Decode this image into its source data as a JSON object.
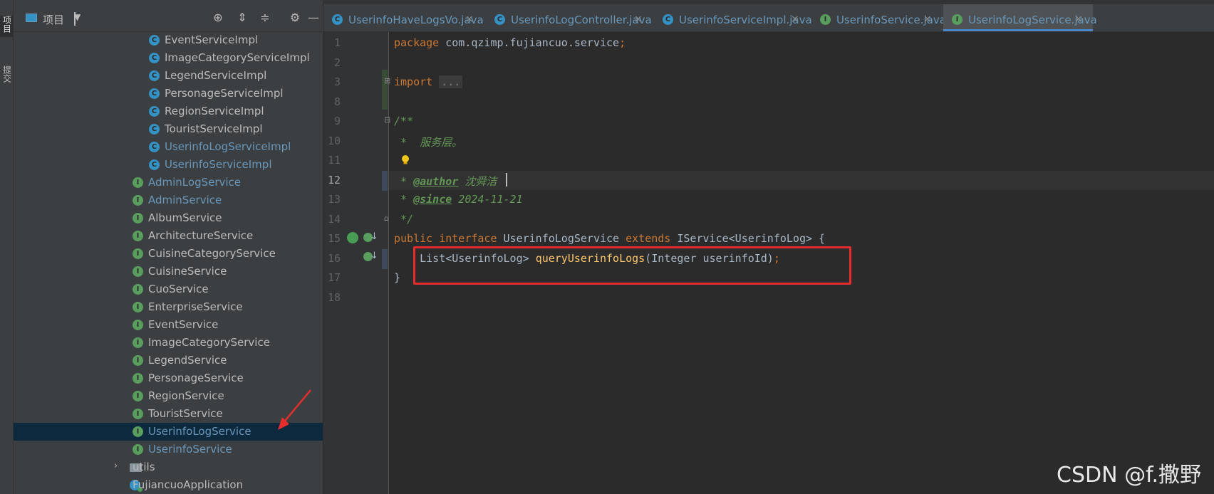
{
  "left_strip": {
    "project_tab": "项目",
    "commit_tab": "提交"
  },
  "project_panel": {
    "title": "项目",
    "tree": [
      {
        "label": "EventServiceImpl",
        "type": "class",
        "modified": false
      },
      {
        "label": "ImageCategoryServiceImpl",
        "type": "class",
        "modified": false
      },
      {
        "label": "LegendServiceImpl",
        "type": "class",
        "modified": false
      },
      {
        "label": "PersonageServiceImpl",
        "type": "class",
        "modified": false
      },
      {
        "label": "RegionServiceImpl",
        "type": "class",
        "modified": false
      },
      {
        "label": "TouristServiceImpl",
        "type": "class",
        "modified": false
      },
      {
        "label": "UserinfoLogServiceImpl",
        "type": "class",
        "modified": true
      },
      {
        "label": "UserinfoServiceImpl",
        "type": "class",
        "modified": true
      },
      {
        "label": "AdminLogService",
        "type": "interface",
        "modified": true
      },
      {
        "label": "AdminService",
        "type": "interface",
        "modified": true
      },
      {
        "label": "AlbumService",
        "type": "interface",
        "modified": false
      },
      {
        "label": "ArchitectureService",
        "type": "interface",
        "modified": false
      },
      {
        "label": "CuisineCategoryService",
        "type": "interface",
        "modified": false
      },
      {
        "label": "CuisineService",
        "type": "interface",
        "modified": false
      },
      {
        "label": "CuoService",
        "type": "interface",
        "modified": false
      },
      {
        "label": "EnterpriseService",
        "type": "interface",
        "modified": false
      },
      {
        "label": "EventService",
        "type": "interface",
        "modified": false
      },
      {
        "label": "ImageCategoryService",
        "type": "interface",
        "modified": false
      },
      {
        "label": "LegendService",
        "type": "interface",
        "modified": false
      },
      {
        "label": "PersonageService",
        "type": "interface",
        "modified": false
      },
      {
        "label": "RegionService",
        "type": "interface",
        "modified": false
      },
      {
        "label": "TouristService",
        "type": "interface",
        "modified": false
      },
      {
        "label": "UserinfoLogService",
        "type": "interface",
        "modified": true,
        "selected": true
      },
      {
        "label": "UserinfoService",
        "type": "interface",
        "modified": true
      },
      {
        "label": "utils",
        "type": "folder",
        "modified": false
      },
      {
        "label": "FujiancuoApplication",
        "type": "app",
        "modified": false
      }
    ]
  },
  "tabs": [
    {
      "label": "UserinfoHaveLogsVo.java",
      "icon": "C",
      "active": false
    },
    {
      "label": "UserinfoLogController.java",
      "icon": "C",
      "active": false
    },
    {
      "label": "UserinfoServiceImpl.java",
      "icon": "C",
      "active": false
    },
    {
      "label": "UserinfoService.java",
      "icon": "I",
      "active": false
    },
    {
      "label": "UserinfoLogService.java",
      "icon": "I",
      "active": true
    }
  ],
  "tab_close_glyph": "×",
  "editor": {
    "line_numbers": [
      "1",
      "2",
      "3",
      "8",
      "9",
      "10",
      "11",
      "12",
      "13",
      "14",
      "15",
      "16",
      "17",
      "18"
    ],
    "current_line": "12",
    "code": {
      "package_kw": "package",
      "package_name": " com.qzimp.fujiancuo.service",
      "semicolon": ";",
      "import_kw": "import",
      "import_fold": "...",
      "doc_open": "/**",
      "doc_desc": " *  服务层。",
      "author_prefix": " * ",
      "author_tag": "@author",
      "author_val": " 沈舜洁",
      "since_prefix": " * ",
      "since_tag": "@since",
      "since_val": " 2024-11-21",
      "doc_close": " */",
      "l15_public": "public",
      "l15_interface": " interface",
      "l15_name": " UserinfoLogService ",
      "l15_extends": "extends",
      "l15_rest": " IService<UserinfoLog> {",
      "l16_type": "    List<UserinfoLog> ",
      "l16_method": "queryUserinfoLogs",
      "l16_params": "(Integer userinfoId)",
      "l16_semi": ";",
      "l17": "}"
    }
  },
  "watermark": "CSDN @f.撒野",
  "colors": {
    "keyword": "#cc7832",
    "comment": "#629755",
    "method": "#ffc66d",
    "modified_file": "#6897bb",
    "highlight_box": "#e52d2d"
  }
}
